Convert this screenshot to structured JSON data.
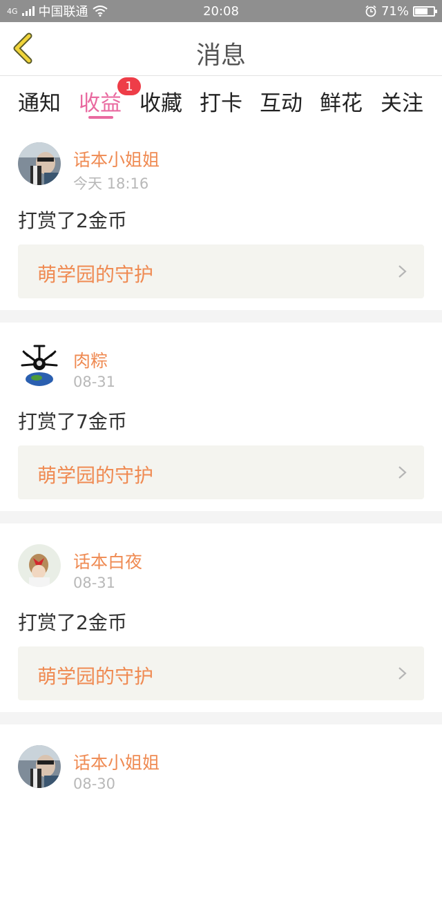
{
  "status_bar": {
    "network": "4G",
    "carrier": "中国联通",
    "time": "20:08",
    "battery": "71%",
    "battery_level": 0.71
  },
  "nav": {
    "title": "消息"
  },
  "tabs": [
    {
      "label": "通知"
    },
    {
      "label": "收益",
      "active": true,
      "badge": "1"
    },
    {
      "label": "收藏"
    },
    {
      "label": "打卡"
    },
    {
      "label": "互动"
    },
    {
      "label": "鲜花"
    },
    {
      "label": "关注"
    }
  ],
  "feed": {
    "items": [
      {
        "user": "话本小姐姐",
        "time": "今天 18:16",
        "message": "打赏了2金币",
        "link": "萌学园的守护"
      },
      {
        "user": "肉粽",
        "time": "08-31",
        "message": "打赏了7金币",
        "link": "萌学园的守护"
      },
      {
        "user": "话本白夜",
        "time": "08-31",
        "message": "打赏了2金币",
        "link": "萌学园的守护"
      },
      {
        "user": "话本小姐姐",
        "time": "08-30",
        "message": "",
        "link": ""
      }
    ]
  },
  "colors": {
    "accent_pink": "#e96aa0",
    "username_orange": "#ef8a52",
    "badge_red": "#ee3d48",
    "back_arrow_yellow": "#f0d43a"
  }
}
